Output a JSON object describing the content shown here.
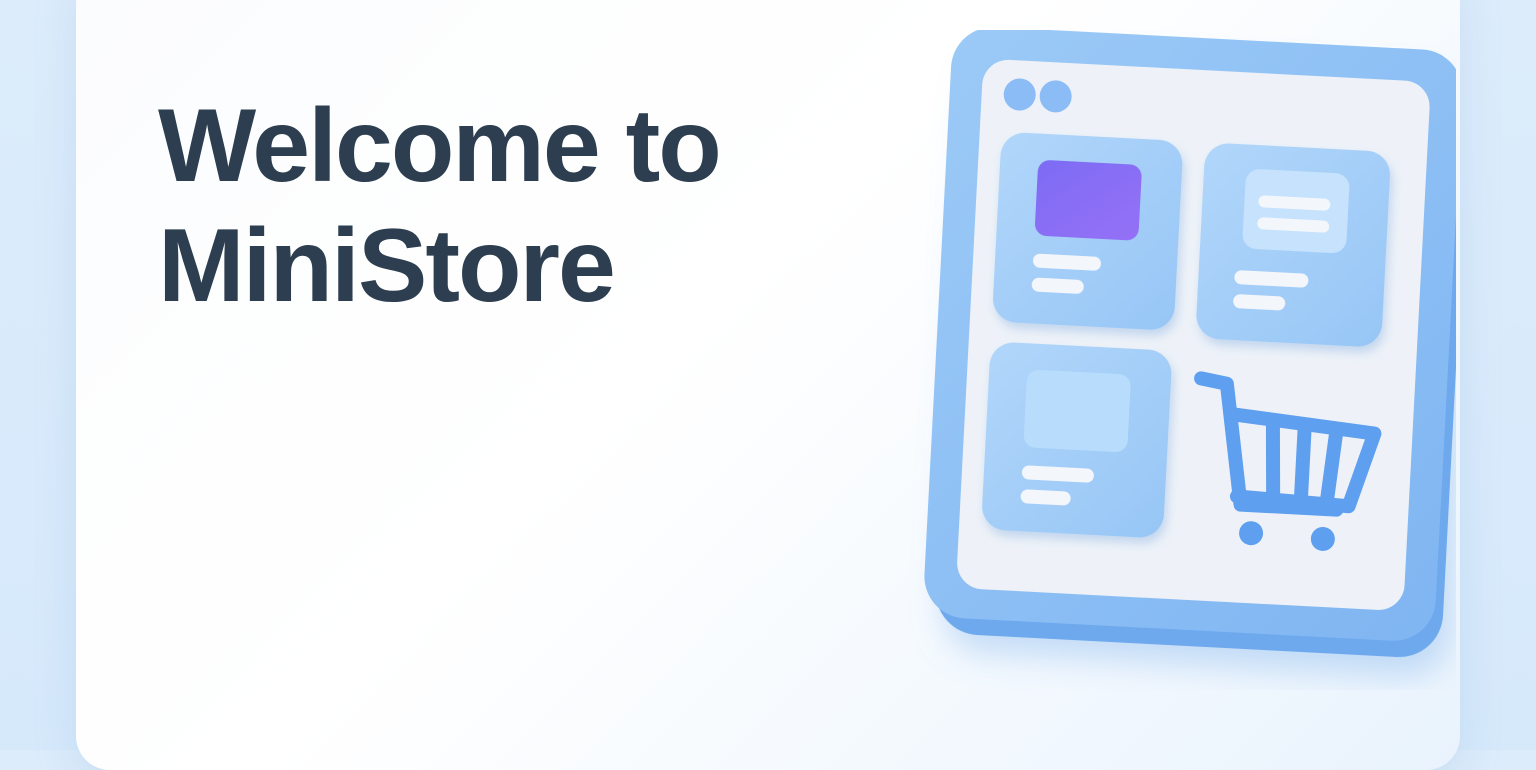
{
  "hero": {
    "title_line1": "Welcome to",
    "title_line2": "MiniStore"
  },
  "illustration": {
    "name": "storefront-window-illustration",
    "icons": [
      "window-dots-icon",
      "product-tile-image-icon",
      "product-tile-text-icon",
      "product-tile-photo-icon",
      "shopping-cart-icon"
    ]
  },
  "colors": {
    "background": "#dcecfb",
    "card": "#ffffff",
    "title_text": "#2c3e4f",
    "frame_blue": "#8ec0f5",
    "tile_blue": "#a2cdf8",
    "accent_purple": "#8a6ff5",
    "cart_blue": "#5e9ff0"
  }
}
